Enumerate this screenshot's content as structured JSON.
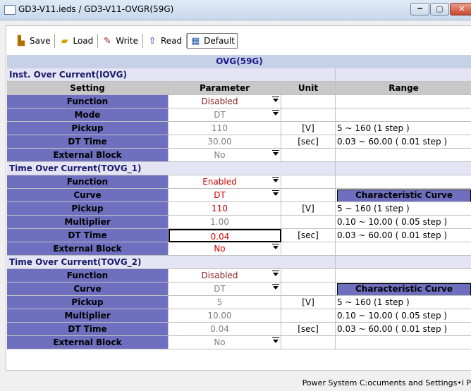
{
  "window": {
    "title": "GD3-V11.ieds / GD3-V11-OVGR(59G)",
    "buttons": {
      "minimize": "━",
      "maximize": "▢",
      "close": "✕"
    }
  },
  "toolbar": {
    "save": "Save",
    "load": "Load",
    "write": "Write",
    "read": "Read",
    "default": "Default"
  },
  "table": {
    "title": "OVG(59G)",
    "columns": {
      "setting": "Setting",
      "parameter": "Parameter",
      "unit": "Unit",
      "range": "Range"
    },
    "sections": {
      "iovg": "Inst. Over Current(IOVG)",
      "tovg1": "Time Over Current(TOVG_1)",
      "tovg2": "Time Over Current(TOVG_2)"
    },
    "iovg": {
      "function": {
        "label": "Function",
        "value": "Disabled"
      },
      "mode": {
        "label": "Mode",
        "value": "DT"
      },
      "pickup": {
        "label": "Pickup",
        "value": "110",
        "unit": "[V]",
        "range": "5 ~ 160 (1 step )"
      },
      "dt_time": {
        "label": "DT Time",
        "value": "30.00",
        "unit": "[sec]",
        "range": "0.03 ~ 60.00 ( 0.01 step )"
      },
      "external_block": {
        "label": "External Block",
        "value": "No"
      }
    },
    "tovg1": {
      "function": {
        "label": "Function",
        "value": "Enabled"
      },
      "curve": {
        "label": "Curve",
        "value": "DT",
        "button": "Characteristic Curve"
      },
      "pickup": {
        "label": "Pickup",
        "value": "110",
        "unit": "[V]",
        "range": "5 ~ 160 (1 step )"
      },
      "multiplier": {
        "label": "Multiplier",
        "value": "1.00",
        "range": "0.10 ~ 10.00 ( 0.05 step )"
      },
      "dt_time": {
        "label": "DT Time",
        "value": "0.04",
        "unit": "[sec]",
        "range": "0.03 ~ 60.00 ( 0.01 step )"
      },
      "external_block": {
        "label": "External Block",
        "value": "No"
      }
    },
    "tovg2": {
      "function": {
        "label": "Function",
        "value": "Disabled"
      },
      "curve": {
        "label": "Curve",
        "value": "DT",
        "button": "Characteristic Curve"
      },
      "pickup": {
        "label": "Pickup",
        "value": "5",
        "unit": "[V]",
        "range": "5 ~ 160 (1 step )"
      },
      "multiplier": {
        "label": "Multiplier",
        "value": "10.00",
        "range": "0.10 ~ 10.00 ( 0.05 step )"
      },
      "dt_time": {
        "label": "DT Time",
        "value": "0.04",
        "unit": "[sec]",
        "range": "0.03 ~ 60.00 ( 0.01 step )"
      },
      "external_block": {
        "label": "External Block",
        "value": "No"
      }
    }
  },
  "status": {
    "text": "Power System   C:ocuments and Settings•l P"
  },
  "colors": {
    "label_bg": "#6f6fc0",
    "enabled_red": "#d00000",
    "section_bg": "#e4e4f4",
    "header_bg": "#c6d0e6"
  }
}
